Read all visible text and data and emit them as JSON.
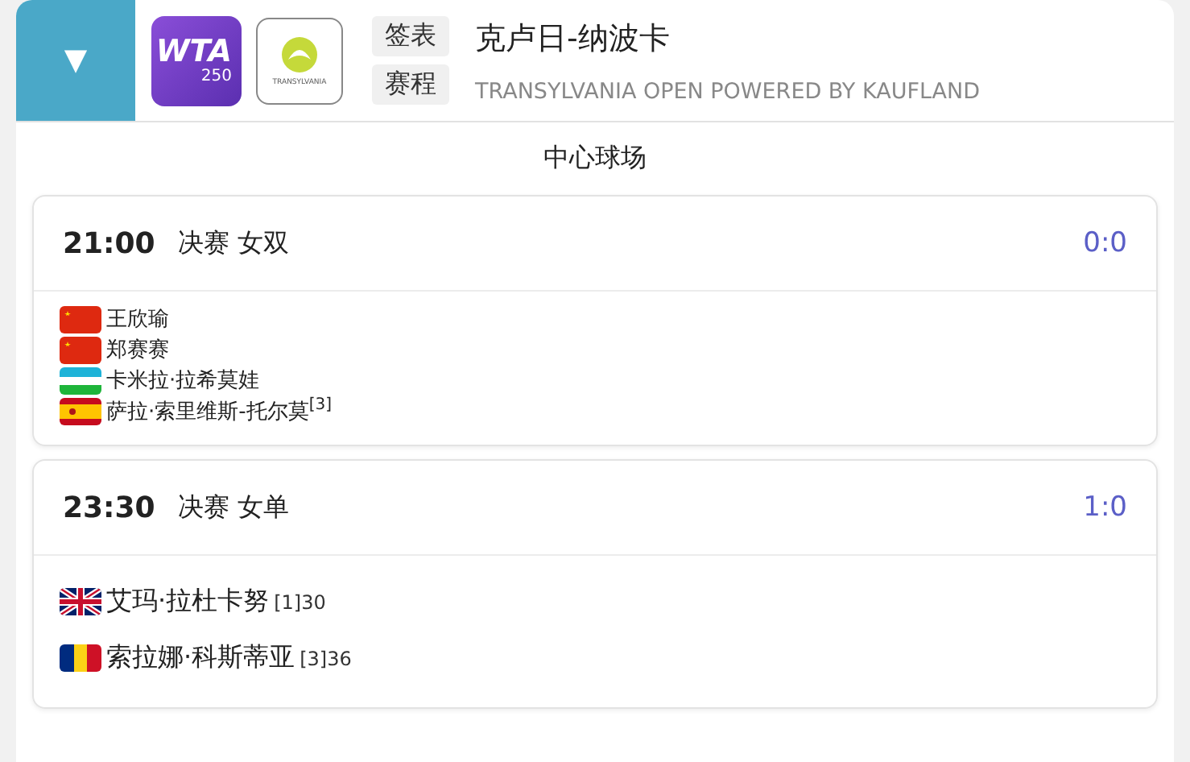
{
  "header": {
    "toggle": "▼",
    "logo": {
      "brand": "WTA",
      "level": "250"
    },
    "tournament_logo": {
      "text": "TRANSYLVANIA"
    },
    "buttons": [
      "签表",
      "赛程"
    ],
    "title": "克卢日-纳波卡",
    "subtitle": "TRANSYLVANIA OPEN POWERED BY KAUFLAND"
  },
  "court": "中心球场",
  "matches": [
    {
      "kind": "doubles",
      "time": "21:00",
      "round": "决赛 女双",
      "score": "0:0",
      "players": [
        {
          "kind": "china",
          "name": "王欣瑜"
        },
        {
          "kind": "china",
          "name": "郑赛赛"
        },
        {
          "kind": "uzbekistan",
          "name": "卡米拉·拉希莫娃"
        },
        {
          "kind": "spain",
          "name": "萨拉·索里维斯-托尔莫$^{[3]}$"
        }
      ]
    },
    {
      "kind": "singles",
      "time": "23:30",
      "round": "决赛 女单",
      "score": "1:0",
      "players": [
        {
          "kind": "britain",
          "name": "艾玛·拉杜卡努",
          "rank": "[1]30"
        },
        {
          "kind": "romania",
          "name": "索拉娜·科斯蒂亚",
          "rank": "[3]36"
        }
      ]
    }
  ]
}
